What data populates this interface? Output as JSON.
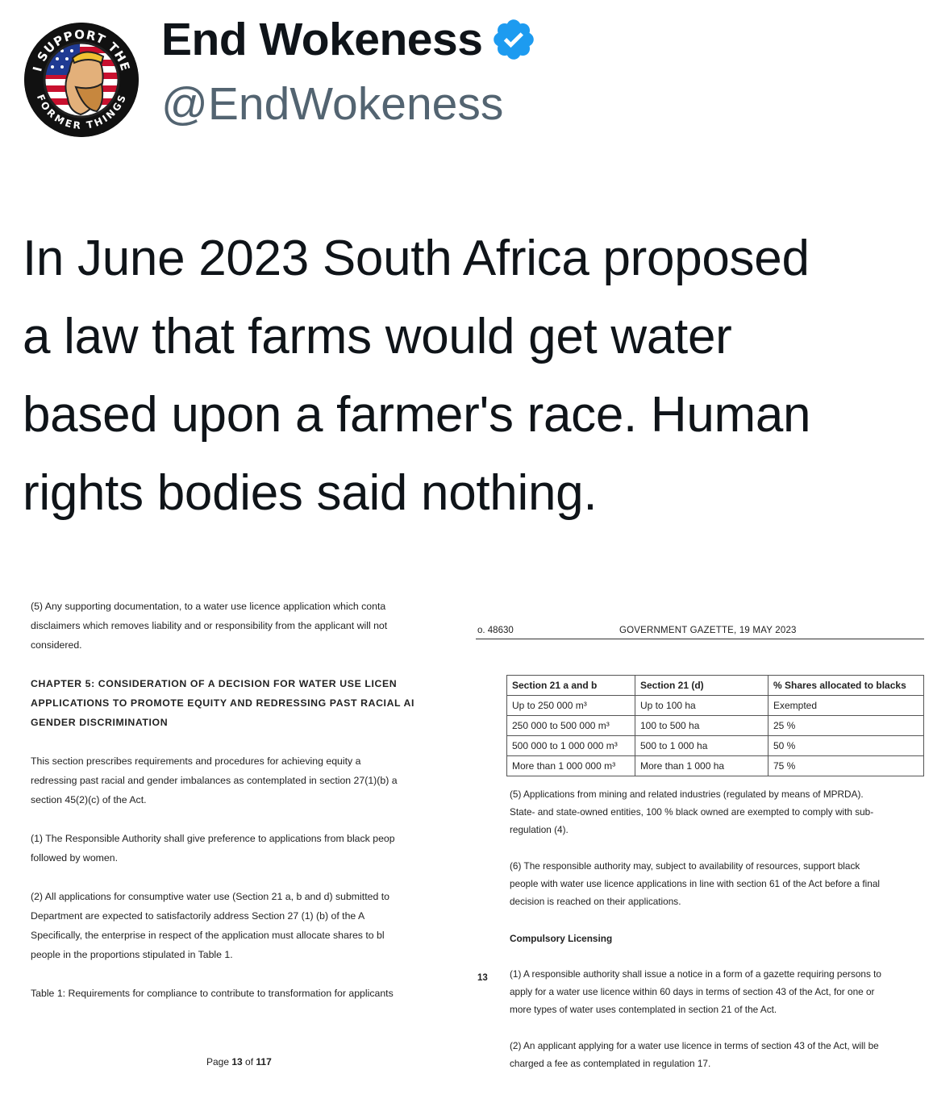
{
  "profile": {
    "display_name": "End Wokeness",
    "handle": "@EndWokeness",
    "avatar_text_top": "I SUPPORT THE",
    "avatar_text_bottom": "FORMER THINGS"
  },
  "tweet": {
    "lines": [
      "In June 2023 South Africa proposed",
      "a law that farms would get water",
      "based upon a farmer's race. Human",
      "rights bodies said nothing."
    ]
  },
  "document_left": {
    "lines": [
      "(5) Any supporting documentation, to a water use licence application which conta",
      "disclaimers which removes liability and or responsibility from the applicant will not",
      "considered.",
      "",
      "CHAPTER 5: CONSIDERATION OF A DECISION FOR WATER USE LICEN",
      "APPLICATIONS TO PROMOTE EQUITY AND REDRESSING PAST RACIAL AI",
      "GENDER DISCRIMINATION",
      "",
      "This section prescribes requirements and procedures for achieving equity a",
      "redressing past racial and gender imbalances as contemplated in section 27(1)(b) a",
      "section 45(2)(c) of the Act.",
      "",
      "(1) The Responsible Authority shall give preference to applications from black peop",
      "followed by women.",
      "",
      "(2) All applications for consumptive water use (Section 21 a, b and d) submitted to",
      "Department are expected to satisfactorily address Section 27 (1) (b) of the A",
      "Specifically, the enterprise in respect of the application must allocate shares to bl",
      "people in the proportions stipulated in Table 1.",
      "",
      "Table 1: Requirements for compliance to contribute to transformation for applicants"
    ],
    "footer_prefix": "Page ",
    "footer_page": "13",
    "footer_of": " of ",
    "footer_total": "117"
  },
  "document_right": {
    "gazette_no": "o. 48630",
    "gazette_title": "GOVERNMENT GAZETTE, 19 MAY 2023",
    "table_headers": [
      "Section 21 a and b",
      "Section 21 (d)",
      "% Shares allocated to blacks"
    ],
    "table_rows": [
      [
        "Up to 250 000 m³",
        "Up to 100 ha",
        "Exempted"
      ],
      [
        "250 000 to 500 000 m³",
        "100 to 500 ha",
        "25 %"
      ],
      [
        "500 000 to 1 000 000 m³",
        "500 to 1 000 ha",
        "50 %"
      ],
      [
        "More than 1 000 000 m³",
        "More than 1 000 ha",
        "75 %"
      ]
    ],
    "para5": [
      "(5) Applications from mining and related industries (regulated by means of MPRDA).",
      "State- and state-owned entities, 100 % black owned are exempted to comply with sub-",
      "regulation (4)."
    ],
    "para6": [
      "(6) The responsible authority may, subject to availability of resources, support black",
      "people with water use licence applications in line with section 61 of the Act before a final",
      "decision is reached on their applications."
    ],
    "heading": "Compulsory Licensing",
    "margin_number": "13",
    "c1": [
      "(1) A responsible authority shall issue a notice in a form of a gazette requiring persons to",
      "apply for a water use licence within 60 days in terms of section 43 of the Act, for one or",
      "more types of water uses contemplated in section 21 of the Act."
    ],
    "c2": [
      "(2) An applicant applying for a water use licence in terms of section 43 of the Act, will be",
      "charged a fee as contemplated in regulation 17."
    ]
  },
  "colors": {
    "verified": "#1d9bf0",
    "handle": "#536471",
    "text": "#0f1419"
  },
  "icons": {
    "verified": "verified-badge-icon"
  }
}
